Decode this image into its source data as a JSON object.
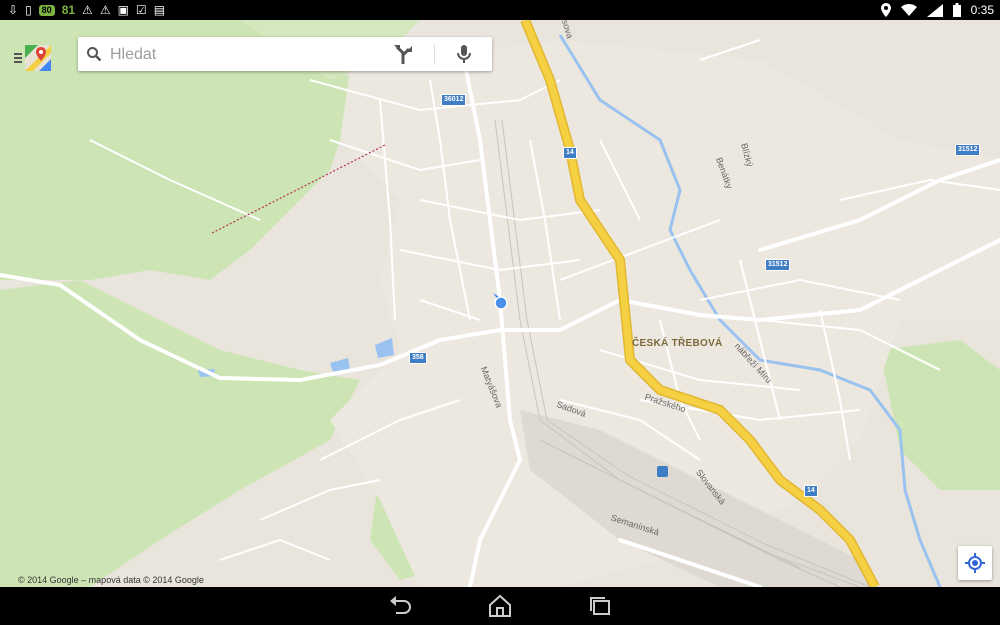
{
  "statusbar": {
    "battery_badge": "80",
    "signal_number": "81",
    "time": "0:35"
  },
  "search": {
    "placeholder": "Hledat",
    "value": ""
  },
  "map": {
    "town_label": "ČESKÁ TŘEBOVÁ",
    "street_labels": {
      "matyasova": "Matyášova",
      "sadova": "Sadová",
      "prazskeho": "Pražského",
      "slovanska": "Slovanská",
      "semaninska": "Semanínská",
      "nabrezi_miru": "nábřeží Míru",
      "benatky": "Benátky",
      "blizky": "Blízký",
      "sova": "sova"
    },
    "route_shields": {
      "r36012": "36012",
      "r14_top": "14",
      "r14_bottom": "14",
      "r31512_a": "31512",
      "r31512_b": "31512",
      "r358": "358"
    },
    "copyright": "© 2014 Google – mapová data © 2014 Google",
    "colors": {
      "land": "#e9e5dc",
      "forest": "#cde5b4",
      "highway": "#f6d043",
      "highway_edge": "#e2b62e",
      "water": "#99c2f0",
      "accent": "#4285f4"
    }
  },
  "icons": {
    "menu": "hamburger-icon",
    "logo": "maps-logo-icon",
    "search": "search-icon",
    "directions": "directions-icon",
    "mic": "mic-icon",
    "mylocation": "my-location-icon",
    "back": "back-icon",
    "home": "home-icon",
    "recents": "recents-icon"
  }
}
